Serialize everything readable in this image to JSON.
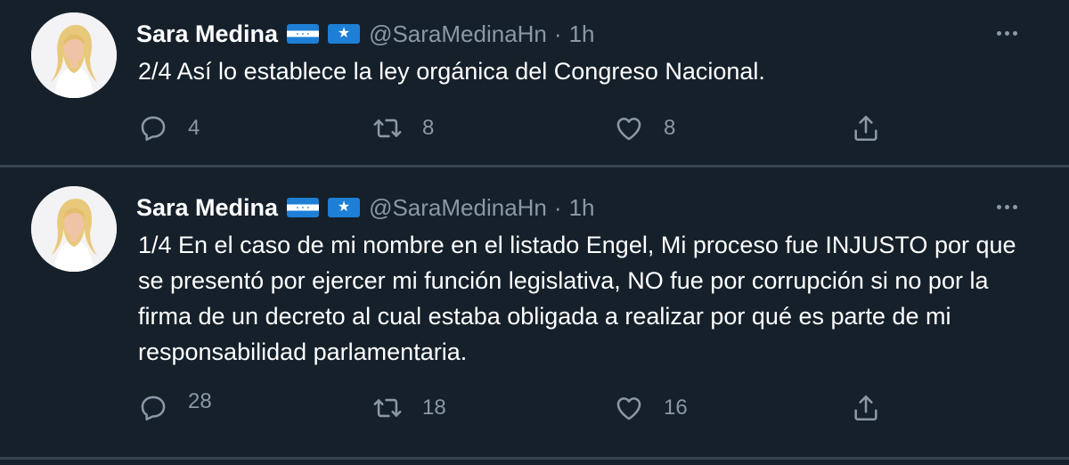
{
  "tweets": [
    {
      "author_name": "Sara Medina",
      "handle": "@SaraMedinaHn",
      "separator": "·",
      "time": "1h",
      "text": "2/4 Así lo establece la ley orgánica del Congreso Nacional.",
      "replies": "4",
      "retweets": "8",
      "likes": "8",
      "badges": [
        "honduras-flag-icon",
        "star-flag-icon"
      ]
    },
    {
      "author_name": "Sara Medina",
      "handle": "@SaraMedinaHn",
      "separator": "·",
      "time": "1h",
      "text": "1/4 En el caso de mi nombre en el listado Engel, Mi proceso fue INJUSTO por que se presentó por ejercer mi función legislativa, NO fue por corrupción si no por la firma de un decreto al cual estaba obligada a realizar por qué es parte de mi responsabilidad parlamentaria.",
      "replies": "28",
      "retweets": "18",
      "likes": "16",
      "badges": [
        "honduras-flag-icon",
        "star-flag-icon"
      ]
    }
  ],
  "colors": {
    "background": "#15202b",
    "text_primary": "#ffffff",
    "text_secondary": "#8b98a5",
    "divider": "#38444d",
    "flag_blue": "#1d7fd6"
  },
  "icons": {
    "reply": "reply-icon",
    "retweet": "retweet-icon",
    "like": "heart-icon",
    "share": "share-icon",
    "more": "more-options-icon"
  }
}
